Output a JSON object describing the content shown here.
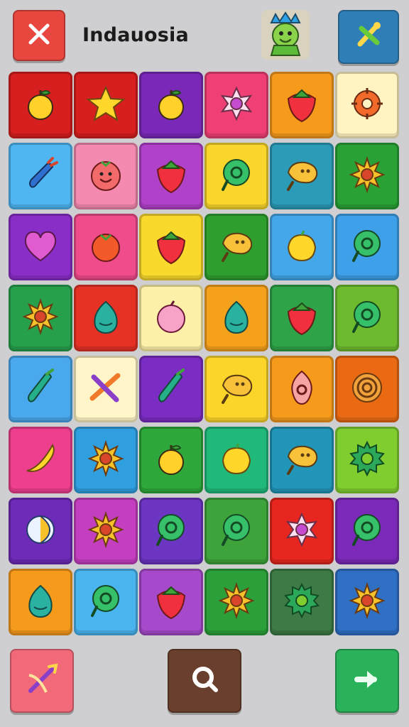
{
  "header": {
    "title": "Indauosia",
    "close_icon": "close-icon",
    "mascot_icon": "mascot-avatar-icon",
    "tool_icon": "crossed-tools-icon"
  },
  "board": {
    "rows": [
      [
        {
          "bg": "#d81f1f",
          "icon": "apple-icon"
        },
        {
          "bg": "#d81f1f",
          "icon": "star-icon"
        },
        {
          "bg": "#7a28b8",
          "icon": "apple-icon"
        },
        {
          "bg": "#ef3f74",
          "icon": "flower-icon"
        },
        {
          "bg": "#f59a1b",
          "icon": "strawberry-icon"
        },
        {
          "bg": "#fff4c2",
          "icon": "gear-flower-icon"
        }
      ],
      [
        {
          "bg": "#4fb6f2",
          "icon": "carrot-icon"
        },
        {
          "bg": "#f48ab0",
          "icon": "smiling-tomato-icon"
        },
        {
          "bg": "#b041c9",
          "icon": "strawberry-icon"
        },
        {
          "bg": "#f8d62b",
          "icon": "ring-pin-icon"
        },
        {
          "bg": "#2b9bb8",
          "icon": "bean-icon"
        },
        {
          "bg": "#2aa135",
          "icon": "sun-icon"
        }
      ],
      [
        {
          "bg": "#8a2ec8",
          "icon": "heart-icon"
        },
        {
          "bg": "#f04b8b",
          "icon": "tomato-icon"
        },
        {
          "bg": "#f9d92b",
          "icon": "strawberry-icon"
        },
        {
          "bg": "#2e9f2e",
          "icon": "bean-icon"
        },
        {
          "bg": "#43a7ea",
          "icon": "lemon-icon"
        },
        {
          "bg": "#3ea0e8",
          "icon": "ring-pin-icon"
        }
      ],
      [
        {
          "bg": "#27a04c",
          "icon": "sun-icon"
        },
        {
          "bg": "#e63225",
          "icon": "onion-icon"
        },
        {
          "bg": "#fdf0a8",
          "icon": "peach-icon"
        },
        {
          "bg": "#f5a11c",
          "icon": "onion-icon"
        },
        {
          "bg": "#2ea347",
          "icon": "strawberry-icon"
        },
        {
          "bg": "#6dba2f",
          "icon": "ring-pin-icon"
        }
      ],
      [
        {
          "bg": "#4aa8ec",
          "icon": "chili-icon"
        },
        {
          "bg": "#fff5c8",
          "icon": "crossed-sticks-icon"
        },
        {
          "bg": "#7b2cc2",
          "icon": "chili-icon"
        },
        {
          "bg": "#fbd52a",
          "icon": "bean-icon"
        },
        {
          "bg": "#f59a1b",
          "icon": "drop-ring-icon"
        },
        {
          "bg": "#ea6a13",
          "icon": "target-icon"
        }
      ],
      [
        {
          "bg": "#ee3f8f",
          "icon": "banana-icon"
        },
        {
          "bg": "#2f9fe0",
          "icon": "sun-icon"
        },
        {
          "bg": "#2ea83a",
          "icon": "apple-icon"
        },
        {
          "bg": "#20b97a",
          "icon": "lemon-icon"
        },
        {
          "bg": "#2196b8",
          "icon": "bean-icon"
        },
        {
          "bg": "#7fcd2e",
          "icon": "gear-icon"
        }
      ],
      [
        {
          "bg": "#6d2bb8",
          "icon": "moon-icon"
        },
        {
          "bg": "#c43fc0",
          "icon": "sun-icon"
        },
        {
          "bg": "#6c35c2",
          "icon": "ring-pin-icon"
        },
        {
          "bg": "#3ea33b",
          "icon": "ring-pin-icon"
        },
        {
          "bg": "#e6261f",
          "icon": "flower-icon"
        },
        {
          "bg": "#7b29b8",
          "icon": "ring-pin-icon"
        }
      ],
      [
        {
          "bg": "#f59a1b",
          "icon": "onion-icon"
        },
        {
          "bg": "#4ab4ef",
          "icon": "ring-pin-icon"
        },
        {
          "bg": "#a64acb",
          "icon": "strawberry-icon"
        },
        {
          "bg": "#2ba03a",
          "icon": "sun-icon"
        },
        {
          "bg": "#3d7a45",
          "icon": "gear-icon"
        },
        {
          "bg": "#2f6fc4",
          "icon": "sun-icon"
        }
      ]
    ]
  },
  "footer": {
    "left_icon": "bow-arrow-icon",
    "center_icon": "search-icon",
    "right_icon": "arrow-right-icon"
  }
}
